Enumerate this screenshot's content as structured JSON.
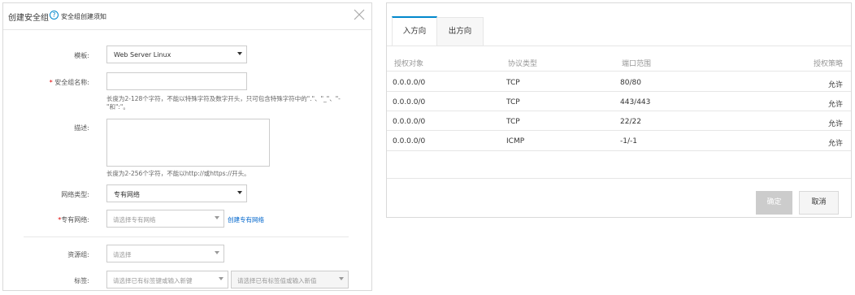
{
  "dialog": {
    "title": "创建安全组",
    "help_link": "安全组创建须知",
    "form": {
      "template": {
        "label": "模板:",
        "value": "Web Server Linux"
      },
      "name": {
        "required_mark": "*",
        "label": "安全组名称:",
        "value": "",
        "hint": "长度为2-128个字符，不能以特殊字符及数字开头，只可包含特殊字符中的\".\"、\"_\"、\"-\"和\":\"。"
      },
      "description": {
        "label": "描述:",
        "value": "",
        "hint": "长度为2-256个字符，不能以http://或https://开头。"
      },
      "network_type": {
        "label": "网络类型:",
        "value": "专有网络"
      },
      "vpc": {
        "required_mark": "*",
        "label": "专有网络:",
        "placeholder": "请选择专有网络",
        "create_link": "创建专有网络"
      },
      "resource_group": {
        "label": "资源组:",
        "placeholder": "请选择"
      },
      "tags": {
        "label": "标签:",
        "key_placeholder": "请选择已有标签键或输入新键",
        "value_placeholder": "请选择已有标签值或输入新值"
      }
    }
  },
  "rules_panel": {
    "tabs": [
      {
        "label": "入方向",
        "active": true
      },
      {
        "label": "出方向",
        "active": false
      }
    ],
    "columns": [
      "授权对象",
      "协议类型",
      "端口范围",
      "授权策略"
    ],
    "rows": [
      {
        "source": "0.0.0.0/0",
        "protocol": "TCP",
        "ports": "80/80",
        "policy": "允许"
      },
      {
        "source": "0.0.0.0/0",
        "protocol": "TCP",
        "ports": "443/443",
        "policy": "允许"
      },
      {
        "source": "0.0.0.0/0",
        "protocol": "TCP",
        "ports": "22/22",
        "policy": "允许"
      },
      {
        "source": "0.0.0.0/0",
        "protocol": "ICMP",
        "ports": "-1/-1",
        "policy": "允许"
      }
    ],
    "buttons": {
      "confirm": "确定",
      "cancel": "取消"
    }
  },
  "icons": {
    "help": "question-circle-icon",
    "close": "close-icon",
    "dropdown": "caret-down-icon"
  },
  "colors": {
    "accent": "#0088cc",
    "link": "#0066cc",
    "required": "#e00000",
    "disabled_button": "#cccccc"
  }
}
